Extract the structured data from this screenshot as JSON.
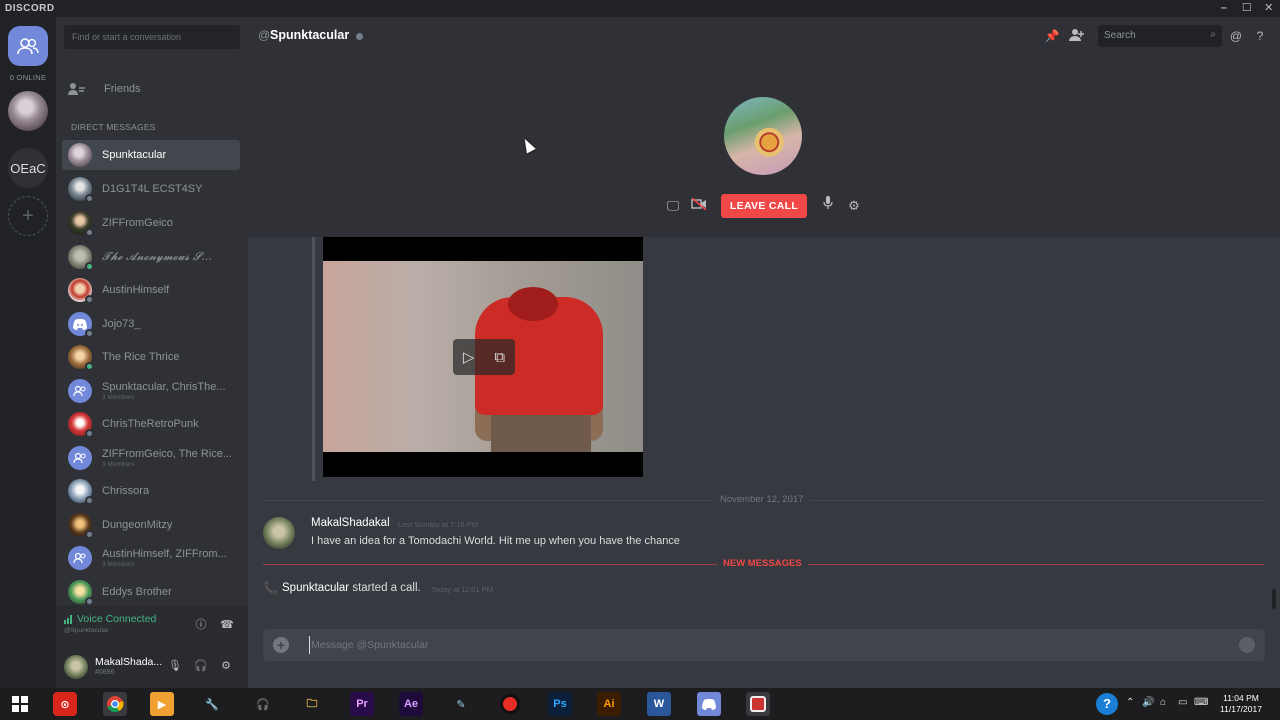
{
  "window": {
    "brand": "DISCORD",
    "controls": [
      "–",
      "☐",
      "✕"
    ]
  },
  "rail": {
    "online_label": "0 ONLINE",
    "server_initials": "OEaC",
    "add_symbol": "+"
  },
  "sidebar": {
    "search_placeholder": "Find or start a conversation",
    "friends_label": "Friends",
    "dm_header": "DIRECT MESSAGES",
    "dms": [
      {
        "name": "Spunktacular",
        "sub": "",
        "active": true
      },
      {
        "name": "D1G1T4L ECST4SY",
        "sub": ""
      },
      {
        "name": "ZIFFromGeico",
        "sub": ""
      },
      {
        "name": "𝓣𝓱𝓮 𝓐𝓷𝓸𝓷𝔂𝓶𝓸𝓾𝓼 𝓢...",
        "sub": ""
      },
      {
        "name": "AustinHimself",
        "sub": ""
      },
      {
        "name": "Jojo73_",
        "sub": ""
      },
      {
        "name": "The Rice Thrice",
        "sub": ""
      },
      {
        "name": "Spunktacular, ChrisThe...",
        "sub": "3 Members"
      },
      {
        "name": "ChrisTheRetroPunk",
        "sub": ""
      },
      {
        "name": "ZIFFromGeico, The Rice...",
        "sub": "3 Members"
      },
      {
        "name": "Chrissora",
        "sub": ""
      },
      {
        "name": "DungeonMitzy",
        "sub": ""
      },
      {
        "name": "AustinHimself, ZIFFrom...",
        "sub": "3 Members"
      },
      {
        "name": "Eddys Brother",
        "sub": ""
      }
    ]
  },
  "voice": {
    "status": "Voice Connected",
    "sub": "@Spunktacular"
  },
  "user": {
    "name": "MakalShada...",
    "tag": "#0896"
  },
  "header": {
    "at": "@",
    "channel": "Spunktacular",
    "search_placeholder": "Search"
  },
  "call": {
    "leave_label": "LEAVE CALL"
  },
  "messages": {
    "day_divider": "November 12, 2017",
    "message": {
      "author": "MakalShadakal",
      "time": "Last Sunday at 7:18 PM",
      "text": "I have an idea for a Tomodachi World. Hit me up when you have the chance"
    },
    "new_divider": "NEW MESSAGES",
    "call_event": {
      "author": "Spunktacular",
      "text": " started a call.",
      "time": "Today at 11:01 PM"
    }
  },
  "composer": {
    "placeholder": "Message @Spunktacular"
  },
  "taskbar": {
    "time": "11:04 PM",
    "date": "11/17/2017",
    "app_labels": {
      "pr": "Pr",
      "ae": "Ae",
      "ps": "Ps",
      "ai": "Ai",
      "w": "W"
    }
  },
  "colors": {
    "accent": "#7289da",
    "danger": "#f04747",
    "online": "#43b581"
  }
}
